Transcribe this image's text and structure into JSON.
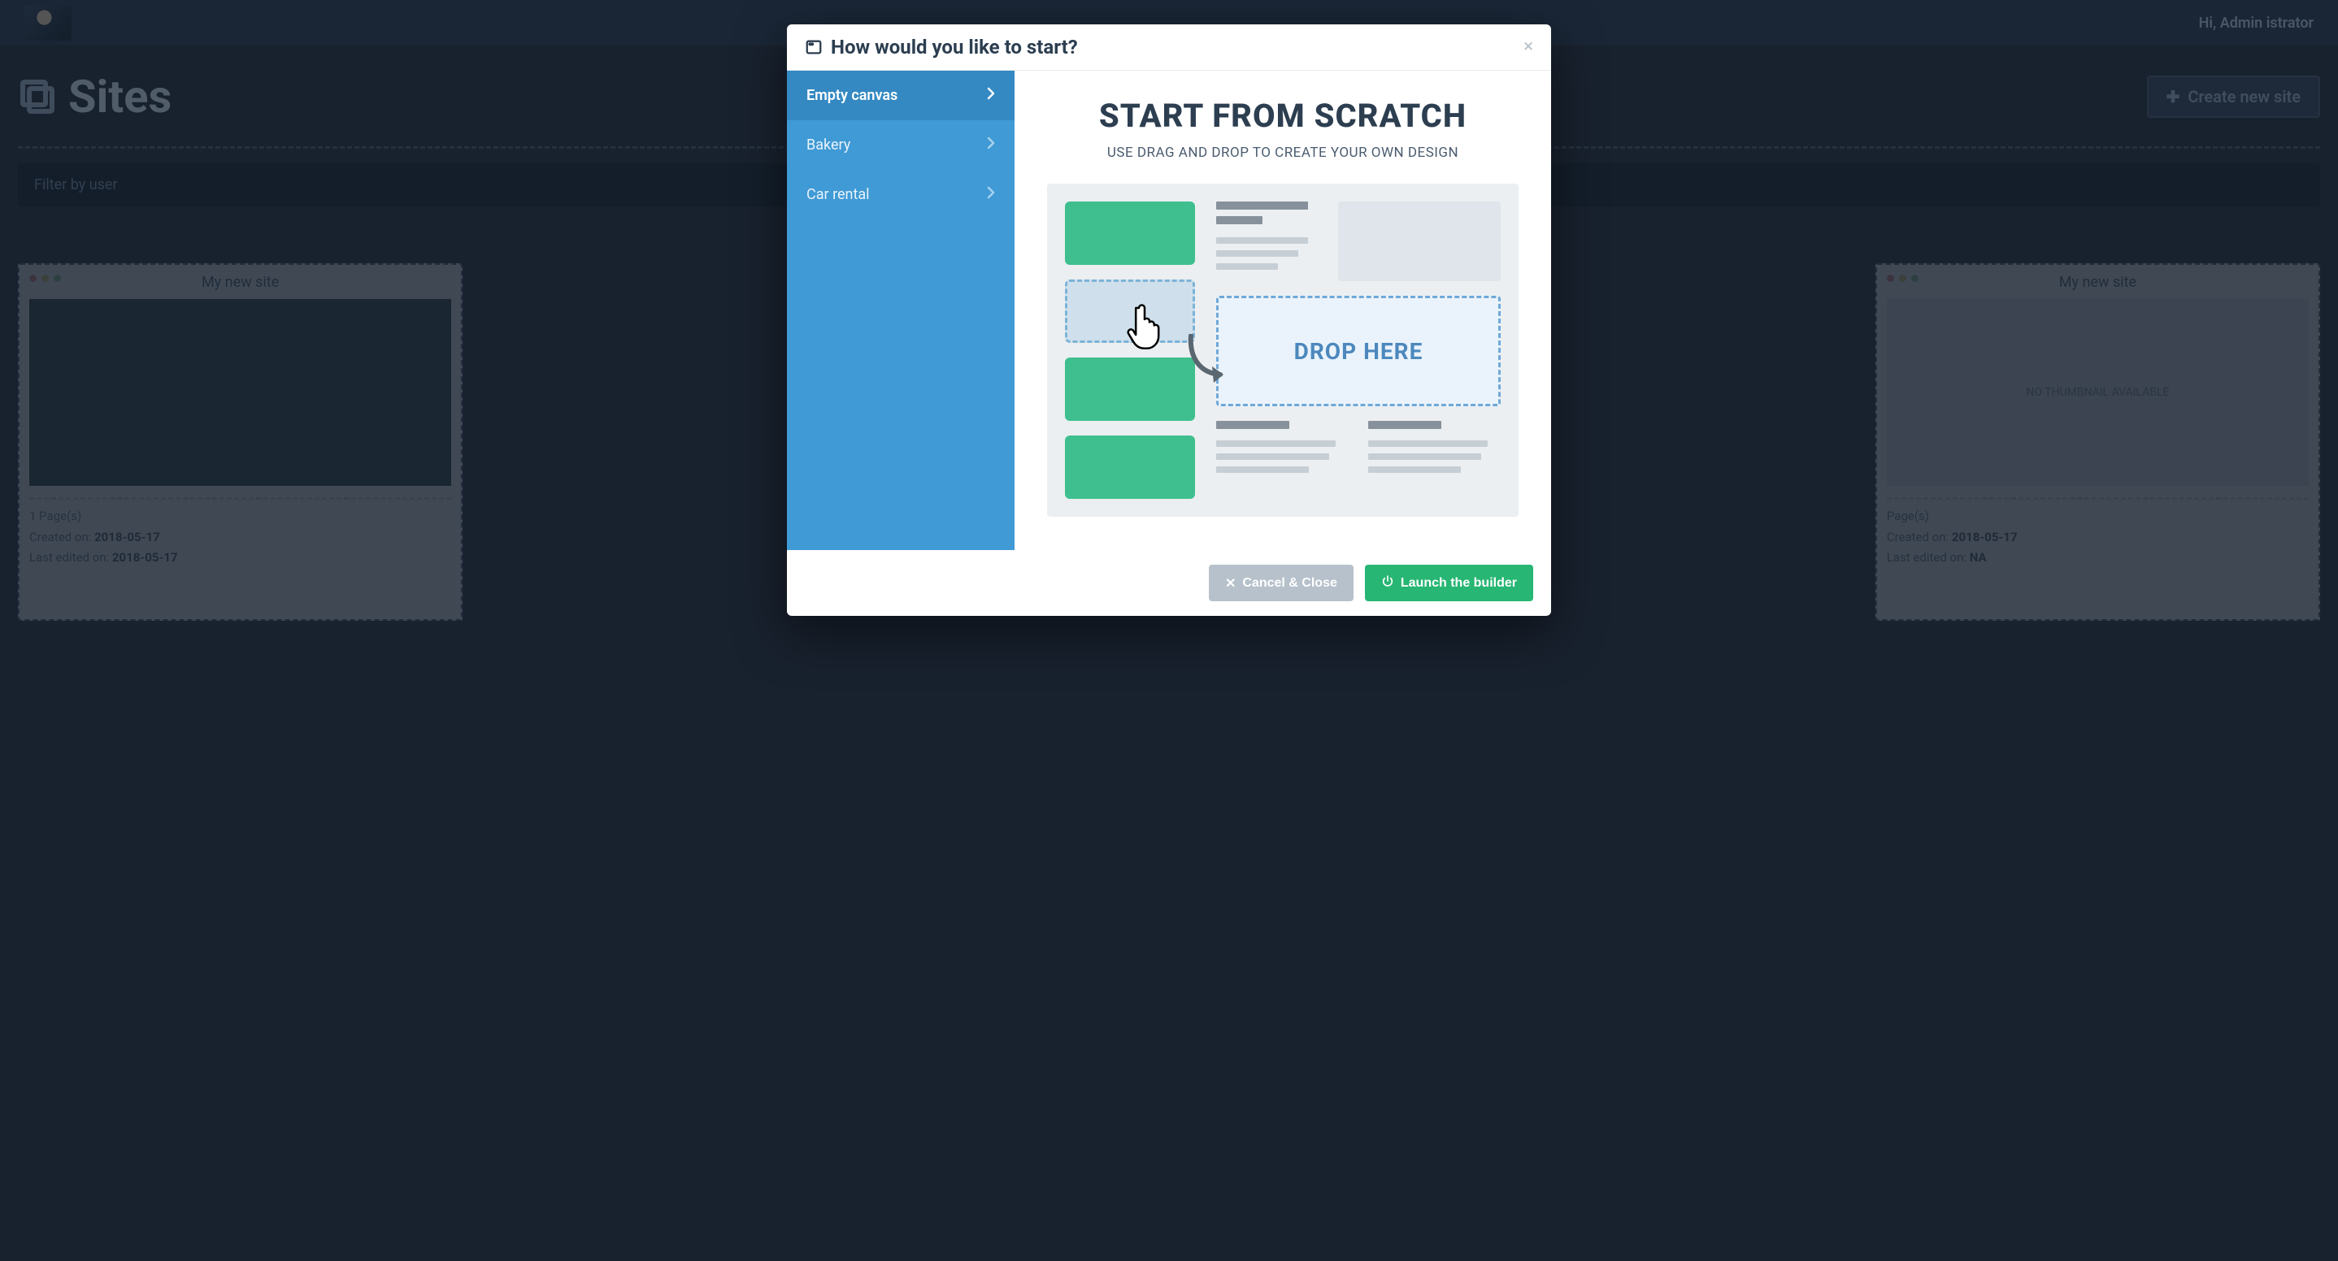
{
  "topbar": {
    "greeting": "Hi, Admin istrator"
  },
  "page": {
    "title": "Sites",
    "create_button": "Create new site",
    "filter_placeholder": "Filter by user"
  },
  "cards": [
    {
      "title": "My new site",
      "pages": "1 Page(s)",
      "created": "Created on:",
      "created_date": "2018-05-17",
      "edited": "Last edited on:",
      "edited_date": "2018-05-17"
    },
    {
      "title": "My new site",
      "pages": "Page(s)",
      "created": "Created on:",
      "created_date": "2018-05-17",
      "edited": "Last edited on:",
      "edited_date": "NA",
      "no_thumb": "NO THUMBNAIL AVAILABLE"
    }
  ],
  "modal": {
    "title": "How would you like to start?",
    "sidebar": {
      "items": [
        {
          "label": "Empty canvas",
          "active": true
        },
        {
          "label": "Bakery",
          "active": false
        },
        {
          "label": "Car rental",
          "active": false
        }
      ]
    },
    "content": {
      "heading": "START FROM SCRATCH",
      "sub": "USE DRAG AND DROP TO CREATE YOUR OWN DESIGN",
      "drop_label": "DROP HERE"
    },
    "footer": {
      "cancel": "Cancel & Close",
      "launch": "Launch the builder"
    }
  }
}
